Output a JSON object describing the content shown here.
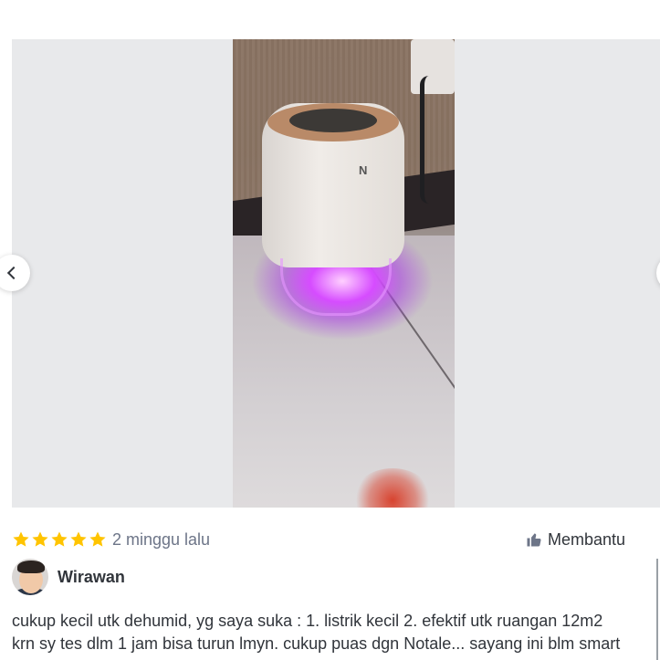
{
  "gallery": {
    "device_logo": "N"
  },
  "review": {
    "rating": 5,
    "max_rating": 5,
    "time_ago": "2 minggu lalu",
    "helpful_label": "Membantu",
    "reviewer_name": "Wirawan",
    "text_line1": "cukup kecil utk dehumid, yg saya suka : 1. listrik kecil 2. efektif utk ruangan 12m2",
    "text_line2": "krn sy tes dlm 1 jam bisa turun lmyn. cukup puas dgn Notale... sayang ini blm smart"
  },
  "colors": {
    "star": "#ffc400",
    "text": "#31353b",
    "muted": "#6d7588",
    "gallery_bg": "#e8e9eb"
  },
  "icons": [
    "chevron-left-icon",
    "chevron-right-icon",
    "star-icon",
    "thumbs-up-icon"
  ]
}
